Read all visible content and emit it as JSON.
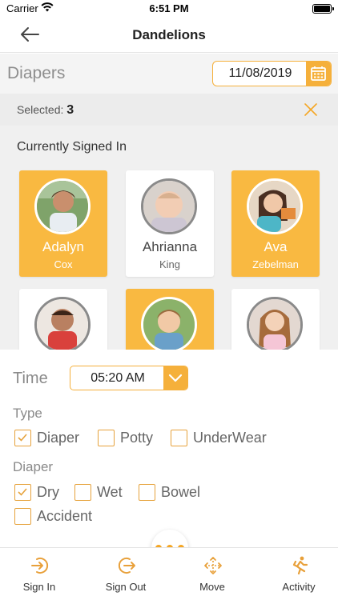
{
  "status_bar": {
    "carrier": "Carrier",
    "time": "6:51 PM"
  },
  "nav": {
    "title": "Dandelions",
    "back_icon": "back-arrow-icon"
  },
  "header": {
    "label": "Diapers",
    "date": "11/08/2019",
    "calendar_icon": "calendar-icon"
  },
  "selection": {
    "label": "Selected:",
    "count": "3",
    "close_icon": "close-icon"
  },
  "roster": {
    "heading": "Currently Signed In",
    "children": [
      {
        "first": "Adalyn",
        "last": "Cox",
        "selected": true
      },
      {
        "first": "Ahrianna",
        "last": "King",
        "selected": false
      },
      {
        "first": "Ava",
        "last": "Zebelman",
        "selected": true
      },
      {
        "first": "",
        "last": "",
        "selected": false
      },
      {
        "first": "",
        "last": "",
        "selected": true
      },
      {
        "first": "",
        "last": "",
        "selected": false
      }
    ]
  },
  "form": {
    "time_label": "Time",
    "time_value": "05:20 AM",
    "type_title": "Type",
    "type_options": [
      {
        "label": "Diaper",
        "checked": true
      },
      {
        "label": "Potty",
        "checked": false
      },
      {
        "label": "UnderWear",
        "checked": false
      }
    ],
    "diaper_title": "Diaper",
    "diaper_options": [
      {
        "label": "Dry",
        "checked": true
      },
      {
        "label": "Wet",
        "checked": false
      },
      {
        "label": "Bowel",
        "checked": false
      },
      {
        "label": "Accident",
        "checked": false
      }
    ]
  },
  "tabs": [
    {
      "label": "Sign In",
      "icon": "sign-in-icon"
    },
    {
      "label": "Sign Out",
      "icon": "sign-out-icon"
    },
    {
      "label": "Move",
      "icon": "move-icon"
    },
    {
      "label": "Activity",
      "icon": "activity-runner-icon"
    }
  ],
  "colors": {
    "accent": "#f9b941",
    "accent_dark": "#f5a623",
    "icon_orange": "#e8a03a"
  }
}
